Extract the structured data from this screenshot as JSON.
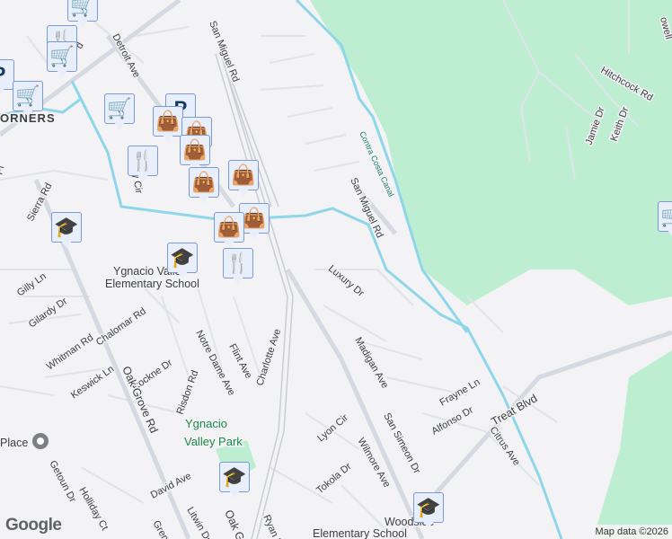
{
  "streets": [
    {
      "id": "detroit",
      "name": "Detroit Ave"
    },
    {
      "id": "sanmiguel1",
      "name": "San Miguel Rd"
    },
    {
      "id": "sanmiguel2",
      "name": "San Miguel Rd"
    },
    {
      "id": "hitchcock",
      "name": "Hitchcock Rd"
    },
    {
      "id": "jamie",
      "name": "Jamie Dr"
    },
    {
      "id": "keith",
      "name": "Keith Dr"
    },
    {
      "id": "sierra",
      "name": "Sierra Rd"
    },
    {
      "id": "gilly",
      "name": "Gilly Ln"
    },
    {
      "id": "gilardy",
      "name": "Gilardy Dr"
    },
    {
      "id": "whitman",
      "name": "Whitman Rd"
    },
    {
      "id": "chalomar",
      "name": "Chalomar Rd"
    },
    {
      "id": "keswick",
      "name": "Keswick Ln"
    },
    {
      "id": "rockne",
      "name": "Rockne Dr"
    },
    {
      "id": "notredame",
      "name": "Notre Dame Ave"
    },
    {
      "id": "flint",
      "name": "Flint Ave"
    },
    {
      "id": "charlotte",
      "name": "Charlotte Ave"
    },
    {
      "id": "risdon",
      "name": "Risdon Rd"
    },
    {
      "id": "oakgrove",
      "name": "Oak Grove Rd"
    },
    {
      "id": "oakgrove2",
      "name": "Oak Gro"
    },
    {
      "id": "luxury",
      "name": "Luxury Dr"
    },
    {
      "id": "madigan",
      "name": "Madigan Ave"
    },
    {
      "id": "frayne",
      "name": "Frayne Ln"
    },
    {
      "id": "alfonso",
      "name": "Alfonso Dr"
    },
    {
      "id": "treat",
      "name": "Treat Blvd"
    },
    {
      "id": "citrus",
      "name": "Citrus Ave"
    },
    {
      "id": "sansimeon",
      "name": "San Simeon Dr"
    },
    {
      "id": "lyon",
      "name": "Lyon Cir"
    },
    {
      "id": "wilmore",
      "name": "Wilmore Ave"
    },
    {
      "id": "tokola",
      "name": "Tokola Dr"
    },
    {
      "id": "david",
      "name": "David Ave"
    },
    {
      "id": "getoun",
      "name": "Getoun Dr"
    },
    {
      "id": "holliday",
      "name": "Holliday Ct"
    },
    {
      "id": "litwin",
      "name": "Litwin Dr"
    },
    {
      "id": "gren",
      "name": "Gren"
    },
    {
      "id": "ryan",
      "name": "Ryan Rd"
    },
    {
      "id": "jrycir",
      "name": "ry Cir"
    },
    {
      "id": "pl",
      "name": "Pl"
    },
    {
      "id": "owell",
      "name": "owell"
    },
    {
      "id": "blvd",
      "name": "d"
    }
  ],
  "places": {
    "corners": "ORNERS",
    "ygnacio_school_1": "Ygnacio Valley",
    "ygnacio_school_2": "Elementary School",
    "ygnacio_park_1": "Ygnacio",
    "ygnacio_park_2": "Valley Park",
    "woodside_1": "Woodside",
    "woodside_2": "Elementary School",
    "place": "Place",
    "canal": "Contra Costa Canal"
  },
  "colors": {
    "background": "#f3f2f4",
    "road": "#d5dae2",
    "water": "#8fd6ea",
    "park": "#bdeed2",
    "marker_bg": "#e8eefa",
    "marker_icon": "#123a63"
  },
  "markers": [
    {
      "type": "shopping-cart",
      "glyph": "🛒"
    },
    {
      "type": "restaurant",
      "glyph": "🍴"
    },
    {
      "type": "shopping-cart",
      "glyph": "🛒"
    },
    {
      "type": "parking",
      "glyph": "P"
    },
    {
      "type": "shopping-cart",
      "glyph": "🛒"
    },
    {
      "type": "shopping-cart",
      "glyph": "🛒"
    },
    {
      "type": "parking",
      "glyph": "P"
    },
    {
      "type": "shopping-bag",
      "glyph": "👜"
    },
    {
      "type": "shopping-bag",
      "glyph": "👜"
    },
    {
      "type": "shopping-bag",
      "glyph": "👜"
    },
    {
      "type": "restaurant",
      "glyph": "🍴"
    },
    {
      "type": "shopping-bag",
      "glyph": "👜"
    },
    {
      "type": "shopping-bag",
      "glyph": "👜"
    },
    {
      "type": "shopping-bag",
      "glyph": "👜"
    },
    {
      "type": "shopping-bag",
      "glyph": "👜"
    },
    {
      "type": "school",
      "glyph": "🎓"
    },
    {
      "type": "school",
      "glyph": "🎓"
    },
    {
      "type": "restaurant",
      "glyph": "🍴"
    },
    {
      "type": "school",
      "glyph": "🎓"
    },
    {
      "type": "school",
      "glyph": "🎓"
    },
    {
      "type": "shopping-cart",
      "glyph": "🛒"
    }
  ],
  "footer": {
    "logo": "Google",
    "attribution": "Map data ©2026"
  }
}
